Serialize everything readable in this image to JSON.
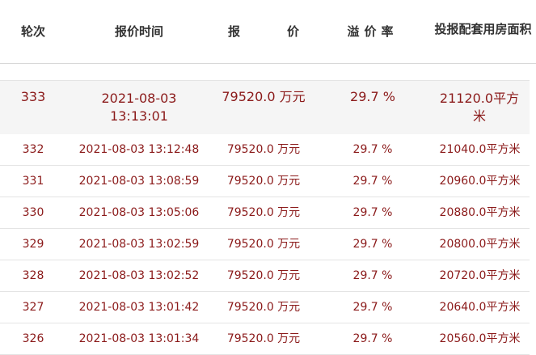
{
  "header": {
    "round": "轮次",
    "time": "报价时间",
    "price_part1": "报",
    "price_part2": "价",
    "premium": "溢价率",
    "area": "投报配套用房面积"
  },
  "colors": {
    "row_text": "#8b1a1a",
    "header_text": "#333333",
    "highlight_row_bg": "#f5f5f5"
  },
  "rows": [
    {
      "round": "333",
      "time": "2021-08-03\n13:13:01",
      "price": "79520.0 万元",
      "premium": "29.7 %",
      "area": "21120.0平方米"
    },
    {
      "round": "332",
      "time": "2021-08-03 13:12:48",
      "price": "79520.0 万元",
      "premium": "29.7 %",
      "area": "21040.0平方米"
    },
    {
      "round": "331",
      "time": "2021-08-03 13:08:59",
      "price": "79520.0 万元",
      "premium": "29.7 %",
      "area": "20960.0平方米"
    },
    {
      "round": "330",
      "time": "2021-08-03 13:05:06",
      "price": "79520.0 万元",
      "premium": "29.7 %",
      "area": "20880.0平方米"
    },
    {
      "round": "329",
      "time": "2021-08-03 13:02:59",
      "price": "79520.0 万元",
      "premium": "29.7 %",
      "area": "20800.0平方米"
    },
    {
      "round": "328",
      "time": "2021-08-03 13:02:52",
      "price": "79520.0 万元",
      "premium": "29.7 %",
      "area": "20720.0平方米"
    },
    {
      "round": "327",
      "time": "2021-08-03 13:01:42",
      "price": "79520.0 万元",
      "premium": "29.7 %",
      "area": "20640.0平方米"
    },
    {
      "round": "326",
      "time": "2021-08-03 13:01:34",
      "price": "79520.0 万元",
      "premium": "29.7 %",
      "area": "20560.0平方米"
    }
  ]
}
